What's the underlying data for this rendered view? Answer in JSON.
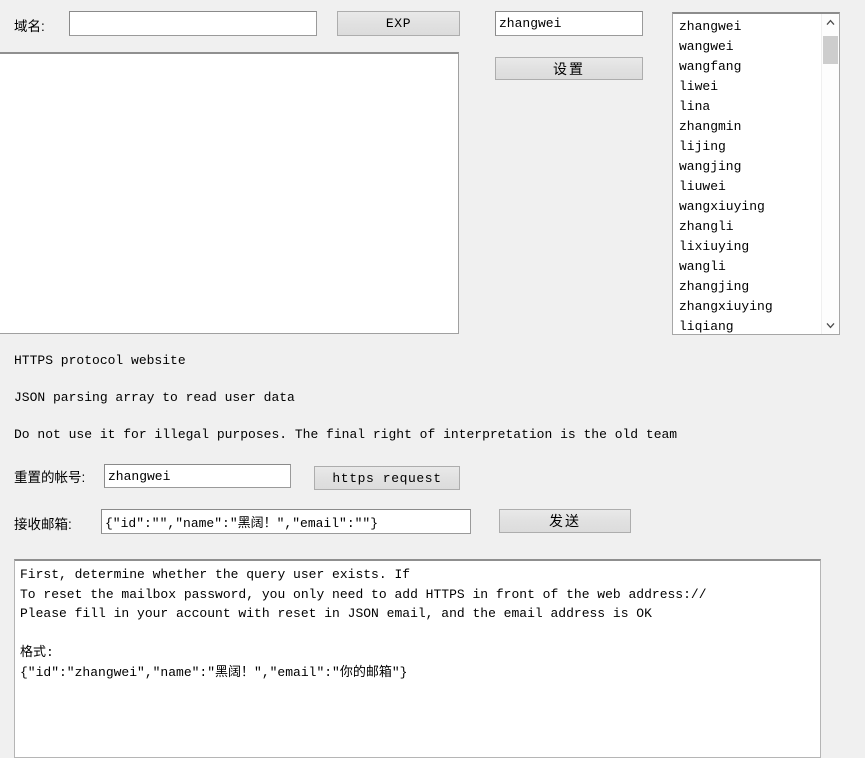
{
  "window": {
    "background_color": "#f0f0f0"
  },
  "top_form": {
    "domain_label": "域名:",
    "domain_value": "",
    "domain_placeholder": "",
    "exp_button": "EXP",
    "account_value": "zhangwei",
    "account_placeholder": "",
    "settings_button": "设置"
  },
  "user_list": {
    "items": [
      "zhangwei",
      "wangwei",
      "wangfang",
      "liwei",
      "lina",
      "zhangmin",
      "lijing",
      "wangjing",
      "liuwei",
      "wangxiuying",
      "zhangli",
      "lixiuying",
      "wangli",
      "zhangjing",
      "zhangxiuying",
      "liqiang"
    ],
    "scroll_up_icon": "chevron-up-icon",
    "scroll_down_icon": "chevron-down-icon"
  },
  "notes": {
    "line1": "HTTPS protocol website",
    "line2": "JSON parsing array to read user data",
    "line3": "Do not use it for illegal purposes. The final right of interpretation is the old team"
  },
  "reset_form": {
    "account_label": "重置的帐号:",
    "account_value": "zhangwei",
    "account_placeholder": "",
    "request_button": "https request",
    "mail_label": "接收邮箱:",
    "mail_value": "{\"id\":\"\",\"name\":\"黑阔！\",\"email\":\"\"}",
    "mail_placeholder": "",
    "send_button": "发送"
  },
  "output": {
    "text": "First, determine whether the query user exists. If\nTo reset the mailbox password, you only need to add HTTPS in front of the web address://\nPlease fill in your account with reset in JSON email, and the email address is OK\n\n格式:\n{\"id\":\"zhangwei\",\"name\":\"黑阔！\",\"email\":\"你的邮箱\"}"
  }
}
